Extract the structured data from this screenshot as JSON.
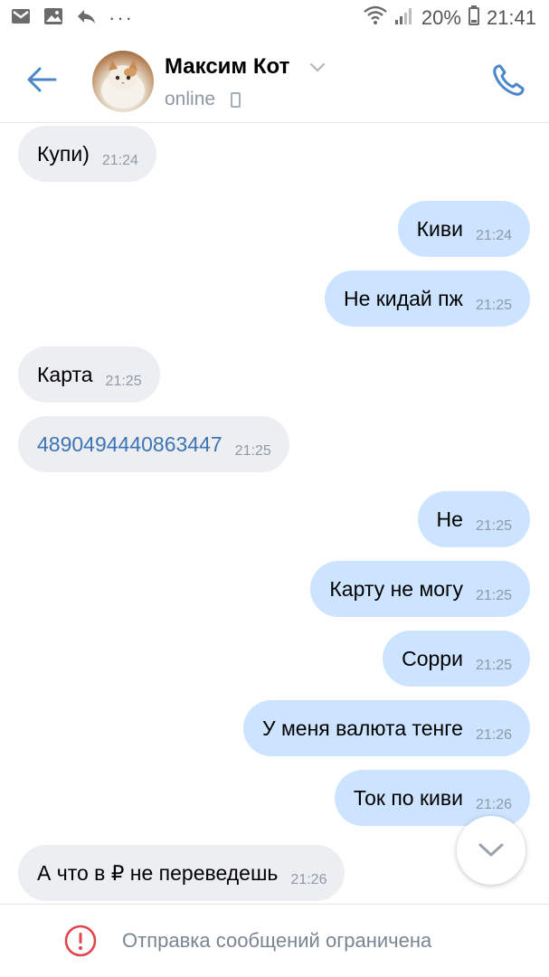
{
  "status_bar": {
    "battery": "20%",
    "time": "21:41",
    "overflow": "···",
    "icons": [
      "gmail-icon",
      "gallery-icon",
      "reply-icon",
      "wifi-icon",
      "signal-icon",
      "battery-icon"
    ]
  },
  "header": {
    "contact_name": "Максим Кот",
    "status": "online",
    "icons": [
      "back-arrow-icon",
      "chevron-down-icon",
      "mobile-icon",
      "phone-icon"
    ]
  },
  "messages": [
    {
      "direction": "in",
      "text": "Купи)",
      "time": "21:24"
    },
    {
      "direction": "out",
      "text": "Киви",
      "time": "21:24"
    },
    {
      "direction": "out",
      "text": "Не кидай пж",
      "time": "21:25"
    },
    {
      "direction": "in",
      "text": "Карта",
      "time": "21:25"
    },
    {
      "direction": "in",
      "text": "4890494440863447",
      "time": "21:25",
      "link": true
    },
    {
      "direction": "out",
      "text": "Не",
      "time": "21:25"
    },
    {
      "direction": "out",
      "text": "Карту не могу",
      "time": "21:25"
    },
    {
      "direction": "out",
      "text": "Сорри",
      "time": "21:25"
    },
    {
      "direction": "out",
      "text": "У меня валюта тенге",
      "time": "21:26"
    },
    {
      "direction": "out",
      "text": "Ток по киви",
      "time": "21:26"
    },
    {
      "direction": "in",
      "text": "А что в ₽ не переведешь",
      "time": "21:26"
    }
  ],
  "footer": {
    "restricted_text": "Отправка сообщений ограничена"
  },
  "colors": {
    "accent": "#4a86c8",
    "incoming_bubble": "#eceef2",
    "outgoing_bubble": "#cce4ff",
    "link": "#3d74b6",
    "warning": "#e0454b"
  }
}
